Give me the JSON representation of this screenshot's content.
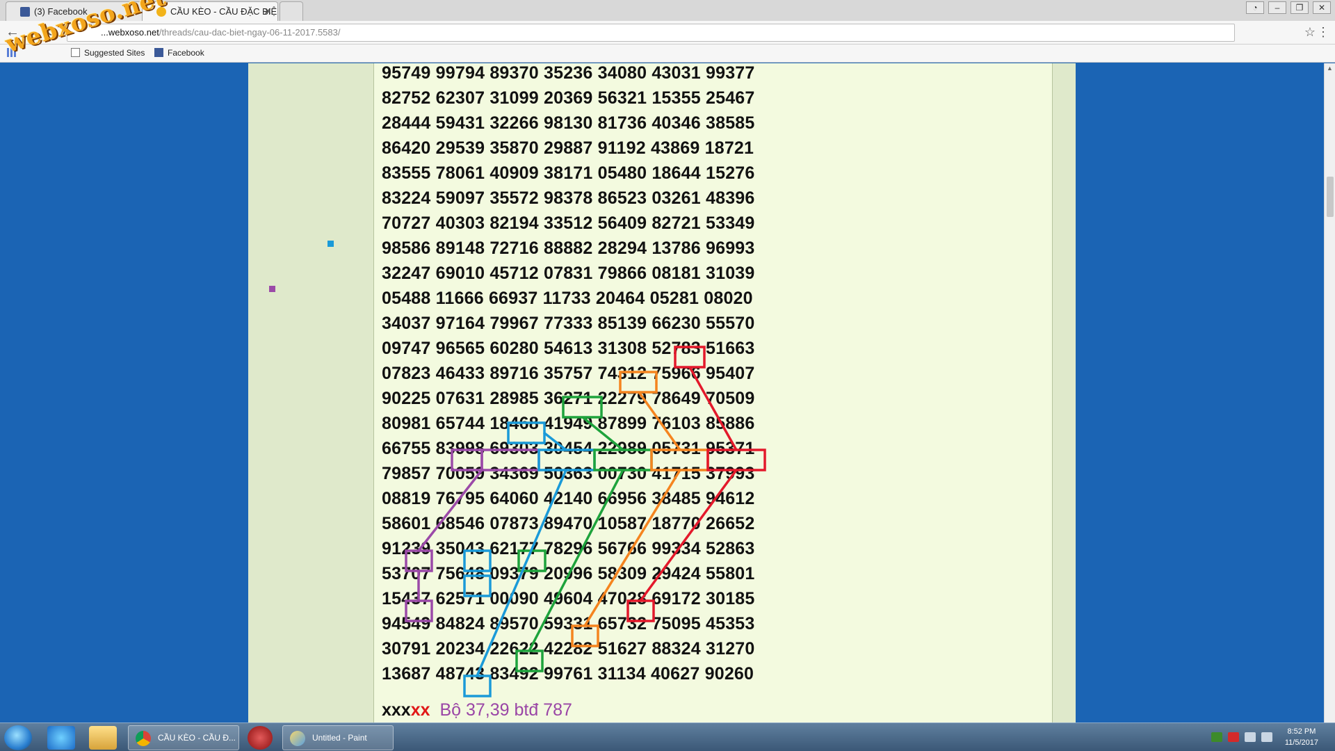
{
  "browser": {
    "tabs": [
      {
        "label": "(3) Facebook",
        "favicon": "facebook-icon",
        "active": false
      },
      {
        "label": "CẦU KÈO - CẦU ĐẶC BIỆ",
        "favicon": "site-favicon",
        "active": true
      }
    ],
    "url_prefix": "...webxoso.net",
    "url_path": "/threads/cau-dac-biet-ngay-06-11-2017.5583/",
    "bookmarks": [
      {
        "label": "Suggested Sites",
        "icon": "page-icon"
      },
      {
        "label": "Facebook",
        "icon": "facebook-icon"
      }
    ],
    "apps_icon": "apps-icon"
  },
  "watermark": {
    "text": "webxoso.net"
  },
  "lottery_rows": [
    "95749 99794 89370 35236 34080 43031 99377",
    "82752 62307 31099 20369 56321 15355 25467",
    "28444 59431 32266 98130 81736 40346 38585",
    "86420 29539 35870 29887 91192 43869 18721",
    "83555 78061 40909 38171 05480 18644 15276",
    "83224 59097 35572 98378 86523 03261 48396",
    "70727 40303 82194 33512 56409 82721 53349",
    "98586 89148 72716 88882 28294 13786 96993",
    "32247 69010 45712 07831 79866 08181 31039",
    "05488 11666 66937 11733 20464 05281 08020",
    "34037 97164 79967 77333 85139 66230 55570",
    "09747 96565 60280 54613 31308 52783 51663",
    "07823 46433 89716 35757 74312 75966 95407",
    "90225 07631 28985 36271 22279 78649 70509",
    "80981 65744 18468 41949 87899 76103 85886",
    "66755 83998 69303 30454 22989 05731 95371",
    "79857 70059 34369 50363 00730 41715 37993",
    "08819 76795 64060 42140 66956 38485 94612",
    "58601 68546 07873 89470 10587 18770 26652",
    "91239 35043 62177 78296 56766 99334 52863",
    "53707 75648 09379 20996 58309 29424 55801",
    "15437 62571 00090 49604 47028 69172 30185",
    "94549 84824 89570 59331 65732 75095 45353",
    "30791 20234 22622 42282 51627 88324 31270",
    "13687 48743 83492 99761 31134 40627 90260"
  ],
  "footer": {
    "prefix_black": "xxx",
    "prefix_red": "xx",
    "note": "Bộ 37,39 btđ 787"
  },
  "colors": {
    "red": "#e3192b",
    "orange": "#f5841f",
    "green": "#1ea33c",
    "blue": "#1a9ad8",
    "purple": "#9b4aa8"
  },
  "taskbar": {
    "apps": [
      {
        "label": "CẦU KÈO - CẦU Đ...",
        "icon": "chrome-icon"
      },
      {
        "label": "Untitled - Paint",
        "icon": "paint-icon"
      }
    ],
    "pinned": [
      "internet-explorer-icon",
      "file-explorer-icon",
      "app-icon"
    ],
    "clock_time": "8:52 PM",
    "clock_date": "11/5/2017"
  }
}
